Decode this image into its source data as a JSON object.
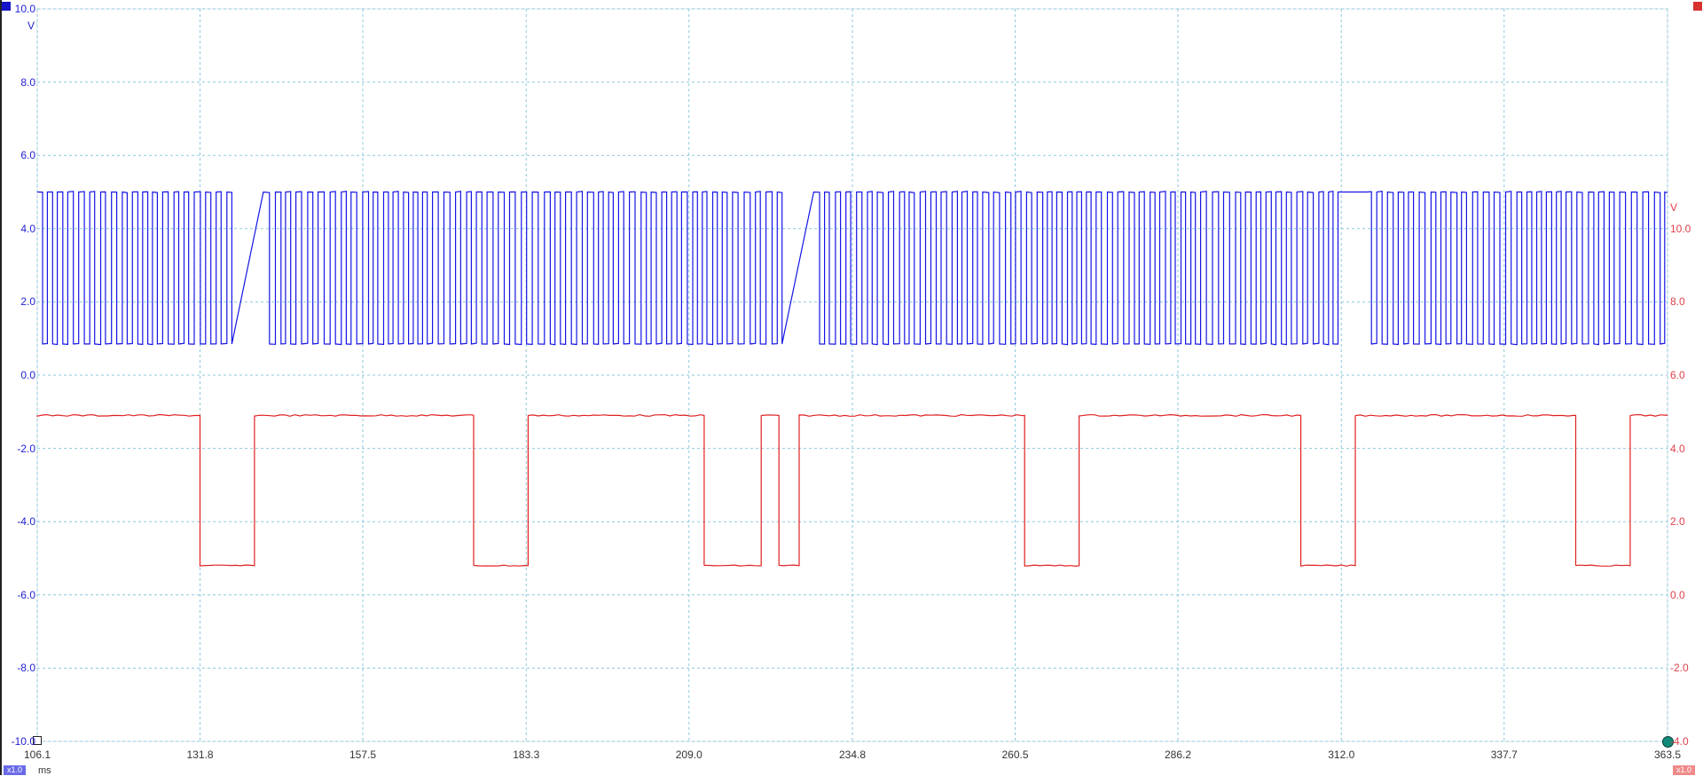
{
  "chart_data": {
    "type": "line",
    "x_unit": "ms",
    "x_ticks": [
      "106.1",
      "131.8",
      "157.5",
      "183.3",
      "209.0",
      "234.8",
      "260.5",
      "286.2",
      "312.0",
      "337.7",
      "363.5"
    ],
    "xlim": [
      106.1,
      363.5
    ],
    "channel_a": {
      "color": "#1414e6",
      "unit_label": "V",
      "scale_badge": "x1.0",
      "ylim": [
        -10,
        10
      ],
      "y_ticks": [
        "10.0",
        "8.0",
        "6.0",
        "4.0",
        "2.0",
        "0.0",
        "-2.0",
        "-4.0",
        "-6.0",
        "-8.0",
        "-10.0"
      ],
      "high_v": 5.0,
      "low_v": 0.85,
      "gaps_ms": [
        [
          136.6,
          141.8
        ],
        [
          223.5,
          228.7
        ],
        [
          310.8,
          316.0
        ]
      ],
      "pulse_period_ms": 1.69
    },
    "channel_b": {
      "color": "#e02020",
      "unit_label": "V",
      "scale_badge": "x1.0",
      "ylim": [
        -4,
        16
      ],
      "y_ticks": [
        "10.0",
        "8.0",
        "6.0",
        "4.0",
        "2.0",
        "0.0",
        "-2.0",
        "-4.0"
      ],
      "high_v": 4.9,
      "low_v": 0.8,
      "low_intervals_ms": [
        [
          131.8,
          140.4
        ],
        [
          175.0,
          183.6
        ],
        [
          211.4,
          220.4
        ],
        [
          223.2,
          226.4
        ],
        [
          262.0,
          270.6
        ],
        [
          305.6,
          314.2
        ],
        [
          349.0,
          357.6
        ]
      ]
    }
  }
}
